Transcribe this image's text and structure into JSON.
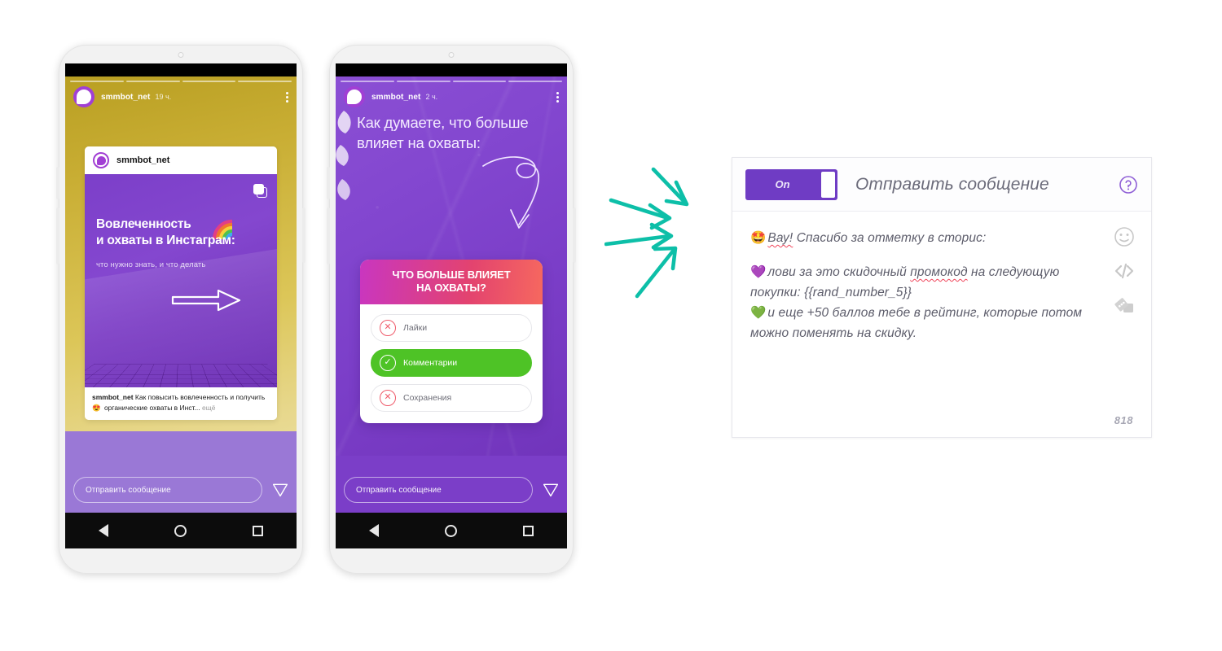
{
  "phone1": {
    "story": {
      "username": "smmbot_net",
      "time": "19 ч.",
      "progress_segments": 4,
      "avatar_icon": "instagram-profile-avatar",
      "more_icon": "more-options-icon"
    },
    "repost": {
      "username": "smmbot_net",
      "title_line1": "Вовлеченность",
      "title_line2": "и охваты в Инстаграм:",
      "subtitle": "что нужно знать, и что делать",
      "carousel_icon": "carousel-icon",
      "arrow_icon": "right-arrow-outline-icon",
      "rainbow_icon": "rainbow-icon"
    },
    "caption": {
      "author": "smmbot_net",
      "text_before_emoji": " Как повысить вовлеченность и получить ",
      "emoji": "😍",
      "text_after_emoji": " органические охваты в Инст",
      "ellipsis": "...",
      "more": "ещё"
    },
    "reply": {
      "placeholder": "Отправить сообщение",
      "send_icon": "send-direct-icon"
    },
    "navbar": {
      "back_icon": "android-back-icon",
      "home_icon": "android-home-icon",
      "recents_icon": "android-recents-icon"
    }
  },
  "phone2": {
    "story": {
      "username": "smmbot_net",
      "time": "2 ч.",
      "progress_segments": 4,
      "avatar_icon": "instagram-profile-avatar",
      "more_icon": "more-options-icon"
    },
    "question_line1": "Как думаете, что больше",
    "question_line2": "влияет на охваты:",
    "curly_arrow_icon": "curly-down-arrow-icon",
    "poll": {
      "title_line1": "ЧТО БОЛЬШЕ ВЛИЯЕТ",
      "title_line2": "НА ОХВАТЫ?",
      "options": [
        {
          "label": "Лайки",
          "state": "wrong",
          "mark_icon": "circle-x-icon"
        },
        {
          "label": "Комментарии",
          "state": "correct",
          "mark_icon": "circle-check-icon"
        },
        {
          "label": "Сохранения",
          "state": "wrong",
          "mark_icon": "circle-x-icon"
        }
      ]
    },
    "reply": {
      "placeholder": "Отправить сообщение",
      "send_icon": "send-direct-icon"
    },
    "navbar": {
      "back_icon": "android-back-icon",
      "home_icon": "android-home-icon",
      "recents_icon": "android-recents-icon"
    }
  },
  "arrows": {
    "icon": "converging-arrows-icon",
    "color": "#0dbfa8",
    "count": 4
  },
  "editor": {
    "toggle": {
      "label": "On",
      "state": "on",
      "color": "#6f3cc4"
    },
    "title": "Отправить сообщение",
    "help_icon": "help-circle-icon",
    "message": {
      "line1_emoji": "🤩",
      "line1_spell": "Вау!",
      "line1_rest": " Спасибо за отметку в сторис:",
      "line2_emoji": "💜",
      "line2_a": "лови за это скидочный ",
      "line2_spell": "промокод",
      "line2_b": " на следующую покупки: {{rand_number_5}}",
      "line3_emoji": "💚",
      "line3": "и еще +50 баллов тебе в рейтинг, которые потом можно поменять на скидку."
    },
    "tools": [
      {
        "icon": "emoji-smiley-icon",
        "name": "emoji-picker"
      },
      {
        "icon": "code-tag-icon",
        "name": "variable-insert"
      },
      {
        "icon": "media-attach-icon",
        "name": "attach-media"
      }
    ],
    "char_counter": "818"
  }
}
